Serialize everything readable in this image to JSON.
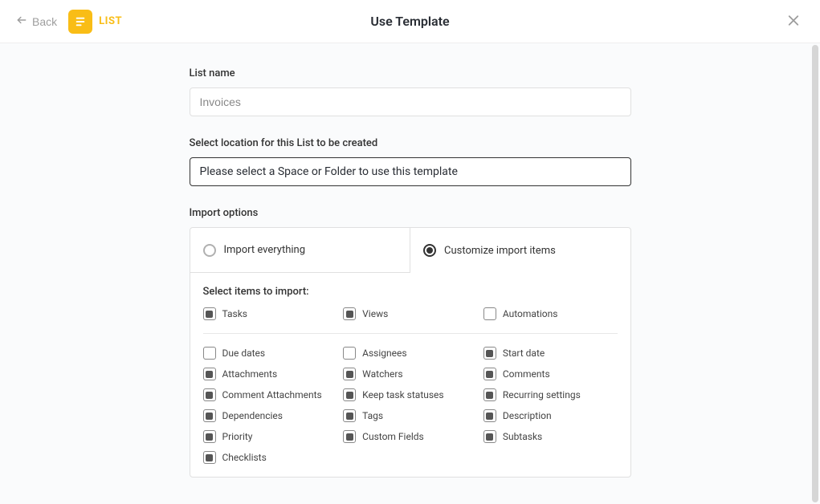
{
  "header": {
    "back_label": "Back",
    "list_badge": "LIST",
    "title": "Use Template"
  },
  "list_name": {
    "label": "List name",
    "placeholder": "Invoices",
    "value": ""
  },
  "location": {
    "label": "Select location for this List to be created",
    "placeholder": "Please select a Space or Folder to use this template"
  },
  "import_options": {
    "label": "Import options",
    "radio_everything": "Import everything",
    "radio_customize": "Customize import items",
    "selected": "customize",
    "select_items_label": "Select items to import:",
    "top_items": [
      {
        "label": "Tasks",
        "checked": true
      },
      {
        "label": "Views",
        "checked": true
      },
      {
        "label": "Automations",
        "checked": false
      }
    ],
    "detail_items": [
      {
        "label": "Due dates",
        "checked": false
      },
      {
        "label": "Assignees",
        "checked": false
      },
      {
        "label": "Start date",
        "checked": true
      },
      {
        "label": "Attachments",
        "checked": true
      },
      {
        "label": "Watchers",
        "checked": true
      },
      {
        "label": "Comments",
        "checked": true
      },
      {
        "label": "Comment Attachments",
        "checked": true
      },
      {
        "label": "Keep task statuses",
        "checked": true
      },
      {
        "label": "Recurring settings",
        "checked": true
      },
      {
        "label": "Dependencies",
        "checked": true
      },
      {
        "label": "Tags",
        "checked": true
      },
      {
        "label": "Description",
        "checked": true
      },
      {
        "label": "Priority",
        "checked": true
      },
      {
        "label": "Custom Fields",
        "checked": true
      },
      {
        "label": "Subtasks",
        "checked": true
      },
      {
        "label": "Checklists",
        "checked": true
      }
    ]
  }
}
